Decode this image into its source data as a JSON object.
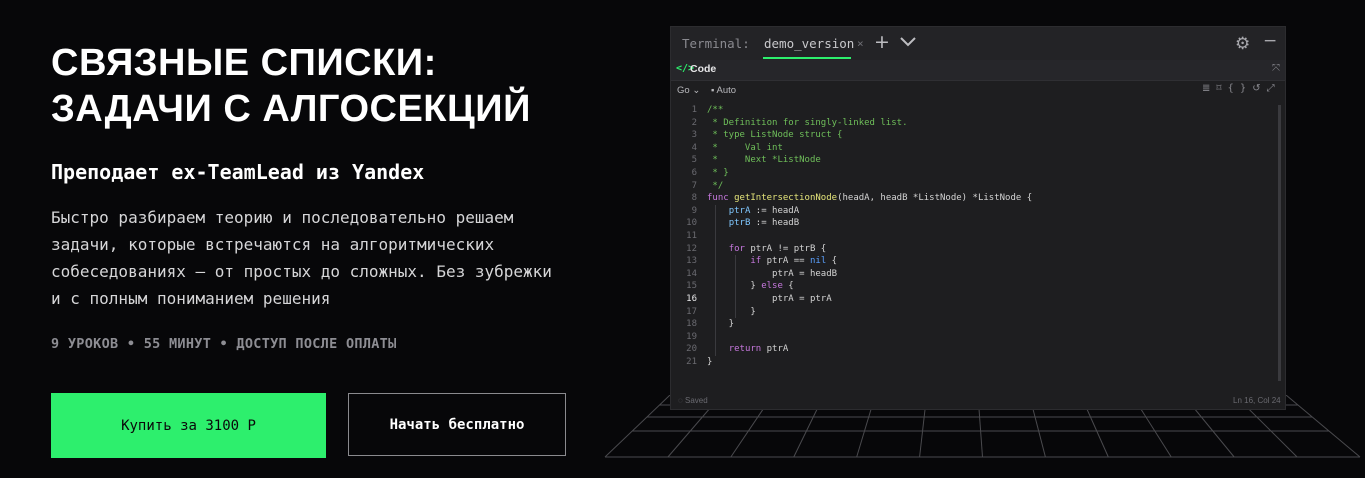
{
  "hero": {
    "title_line1": "СВЯЗНЫЕ СПИСКИ:",
    "title_line2": "ЗАДАЧИ С АЛГОСЕКЦИЙ",
    "subtitle": "Преподает ex-TeamLead из Yandex",
    "description": "Быстро разбираем теорию и последовательно решаем задачи, которые встречаются на алгоритмических собеседованиях — от простых до сложных. Без зубрежки и с полным пониманием решения",
    "meta": "9 УРОКОВ • 55 МИНУТ • ДОСТУП ПОСЛЕ ОПЛАТЫ",
    "buy_label": "Купить за 3100 Р",
    "free_label": "Начать бесплатно"
  },
  "editor": {
    "terminal_label": "Terminal:",
    "tab_name": "demo_version",
    "tab_close": "×",
    "code_panel_label": "Code",
    "language": "Go",
    "mode": "Auto",
    "status_saved": "Saved",
    "status_position": "Ln 16, Col 24",
    "current_line": 16,
    "lines": [
      {
        "n": "1",
        "code": "/**"
      },
      {
        "n": "2",
        "code": " * Definition for singly-linked list."
      },
      {
        "n": "3",
        "code": " * type ListNode struct {"
      },
      {
        "n": "4",
        "code": " *     Val int"
      },
      {
        "n": "5",
        "code": " *     Next *ListNode"
      },
      {
        "n": "6",
        "code": " * }"
      },
      {
        "n": "7",
        "code": " */"
      },
      {
        "n": "8",
        "code": "func getIntersectionNode(headA, headB *ListNode) *ListNode {"
      },
      {
        "n": "9",
        "code": "    ptrA := headA"
      },
      {
        "n": "10",
        "code": "    ptrB := headB"
      },
      {
        "n": "11",
        "code": ""
      },
      {
        "n": "12",
        "code": "    for ptrA != ptrB {"
      },
      {
        "n": "13",
        "code": "        if ptrA == nil {"
      },
      {
        "n": "14",
        "code": "            ptrA = headB"
      },
      {
        "n": "15",
        "code": "        } else {"
      },
      {
        "n": "16",
        "code": "            ptrA = ptrA"
      },
      {
        "n": "17",
        "code": "        }"
      },
      {
        "n": "18",
        "code": "    }"
      },
      {
        "n": "19",
        "code": ""
      },
      {
        "n": "20",
        "code": "    return ptrA"
      },
      {
        "n": "21",
        "code": "}"
      }
    ],
    "icons": [
      "code-icon",
      "expand-icon",
      "chevron-down-icon",
      "format-icon",
      "bookmark-icon",
      "braces-icon",
      "undo-icon",
      "fullscreen-icon",
      "gear-icon",
      "minus-icon",
      "plus-icon",
      "saved-icon"
    ],
    "colors": {
      "accent": "#2def6d",
      "keyword": "#c678dd",
      "function": "#e5e57a",
      "comment": "#6fbf5a",
      "variable": "#80c8ff"
    }
  }
}
